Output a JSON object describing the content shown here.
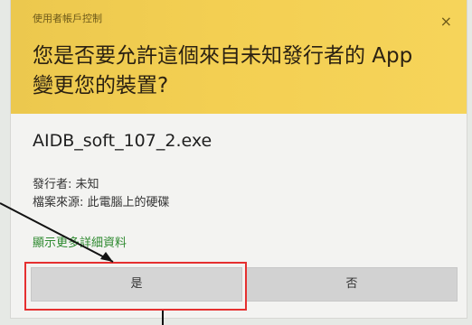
{
  "dialog": {
    "uac_title": "使用者帳戶控制",
    "close_glyph": "×",
    "headline": "您是否要允許這個來自未知發行者的 App 變更您的裝置?",
    "filename": "AIDB_soft_107_2.exe",
    "publisher": "發行者: 未知",
    "origin": "檔案來源: 此電腦上的硬碟",
    "more_link": "顯示更多詳細資料",
    "yes_label": "是",
    "no_label": "否"
  },
  "colors": {
    "header": "#f3cf52",
    "link": "#2e8a30",
    "annotation": "#e53030"
  }
}
